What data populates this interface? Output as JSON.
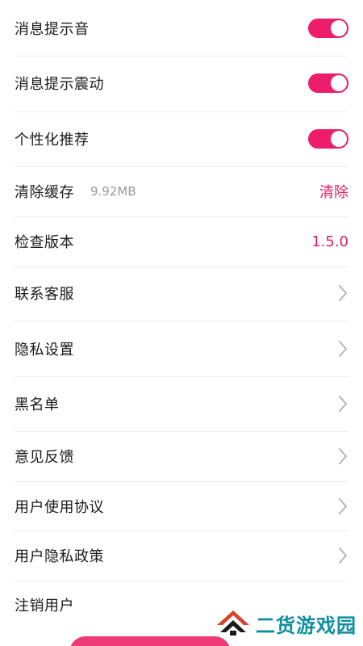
{
  "accent_color": "#e11d6a",
  "settings": {
    "message_sound": {
      "label": "消息提示音",
      "enabled": true
    },
    "message_vibrate": {
      "label": "消息提示震动",
      "enabled": true
    },
    "personalized": {
      "label": "个性化推荐",
      "enabled": true
    },
    "clear_cache": {
      "label": "清除缓存",
      "size": "9.92MB",
      "action": "清除"
    },
    "check_version": {
      "label": "检查版本",
      "version": "1.5.0"
    },
    "contact_service": {
      "label": "联系客服"
    },
    "privacy_settings": {
      "label": "隐私设置"
    },
    "blacklist": {
      "label": "黑名单"
    },
    "feedback": {
      "label": "意见反馈"
    },
    "user_agreement": {
      "label": "用户使用协议"
    },
    "privacy_policy": {
      "label": "用户隐私政策"
    },
    "cancel_account": {
      "label": "注销用户"
    }
  },
  "watermark": {
    "text": "二货游戏园"
  }
}
